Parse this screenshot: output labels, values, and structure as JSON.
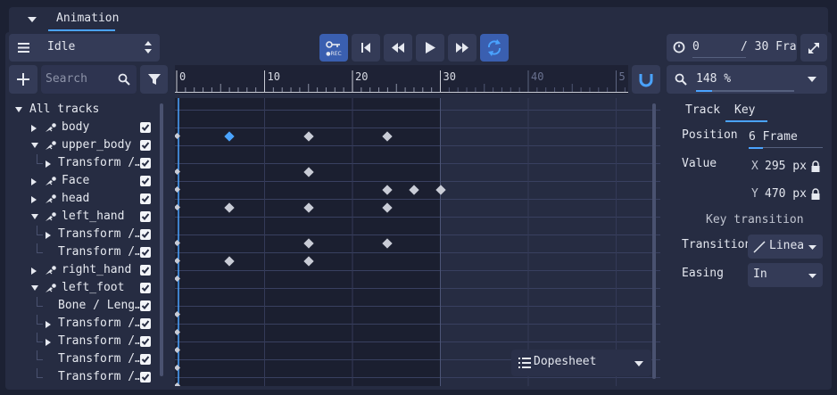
{
  "tab": {
    "label": "Animation"
  },
  "animation_select": {
    "value": "Idle"
  },
  "transport": {
    "buttons": [
      "rec-key",
      "jump-start",
      "step-back",
      "play",
      "step-forward",
      "loop"
    ],
    "current_frame": "0",
    "total_frames": "/ 30 Fra"
  },
  "search": {
    "placeholder": "Search"
  },
  "timeline": {
    "ticks": [
      "0",
      "10",
      "20",
      "30",
      "40",
      "5"
    ],
    "zoom": "148 %",
    "length_frames": 30
  },
  "tracks": [
    {
      "label": "All tracks",
      "indent": 0,
      "expand": "down",
      "icon": false,
      "check": false
    },
    {
      "label": "body",
      "indent": 1,
      "expand": "right",
      "icon": true,
      "check": true,
      "keys": [
        [
          0,
          false
        ],
        [
          6,
          true
        ],
        [
          15,
          false
        ],
        [
          24,
          false
        ]
      ]
    },
    {
      "label": "upper_body",
      "indent": 1,
      "expand": "down",
      "icon": true,
      "check": true,
      "keys": []
    },
    {
      "label": "Transform /…",
      "indent": 2,
      "expand": "right",
      "icon": false,
      "check": true,
      "keys": [
        [
          0,
          false
        ],
        [
          15,
          false
        ]
      ]
    },
    {
      "label": "Face",
      "indent": 1,
      "expand": "right",
      "icon": true,
      "check": true,
      "keys": [
        [
          0,
          false
        ],
        [
          24,
          false
        ],
        [
          27,
          false
        ],
        [
          30,
          false
        ]
      ]
    },
    {
      "label": "head",
      "indent": 1,
      "expand": "right",
      "icon": true,
      "check": true,
      "keys": [
        [
          0,
          false
        ],
        [
          6,
          false
        ],
        [
          15,
          false
        ],
        [
          24,
          false
        ]
      ]
    },
    {
      "label": "left_hand",
      "indent": 1,
      "expand": "down",
      "icon": true,
      "check": true,
      "keys": []
    },
    {
      "label": "Transform /…",
      "indent": 2,
      "expand": "right",
      "icon": false,
      "check": true,
      "keys": [
        [
          0,
          false
        ],
        [
          15,
          false
        ],
        [
          24,
          false
        ]
      ]
    },
    {
      "label": "Transform /…",
      "indent": 2,
      "expand": "none",
      "icon": false,
      "check": true,
      "keys": [
        [
          0,
          false
        ],
        [
          6,
          false
        ],
        [
          15,
          false
        ]
      ]
    },
    {
      "label": "right_hand",
      "indent": 1,
      "expand": "right",
      "icon": true,
      "check": true,
      "keys": [
        [
          0,
          false
        ]
      ]
    },
    {
      "label": "left_foot",
      "indent": 1,
      "expand": "down",
      "icon": true,
      "check": true,
      "keys": []
    },
    {
      "label": "Bone / Leng…",
      "indent": 2,
      "expand": "none",
      "icon": false,
      "check": true,
      "keys": [
        [
          0,
          false
        ]
      ]
    },
    {
      "label": "Transform /…",
      "indent": 2,
      "expand": "right",
      "icon": false,
      "check": true,
      "keys": [
        [
          0,
          false
        ]
      ]
    },
    {
      "label": "Transform /…",
      "indent": 2,
      "expand": "right",
      "icon": false,
      "check": true,
      "keys": [
        [
          0,
          false
        ]
      ]
    },
    {
      "label": "Transform /…",
      "indent": 2,
      "expand": "none",
      "icon": false,
      "check": true,
      "keys": [
        [
          0,
          false
        ]
      ]
    },
    {
      "label": "Transform /…",
      "indent": 2,
      "expand": "none",
      "icon": false,
      "check": true,
      "keys": [
        [
          0,
          false
        ]
      ]
    }
  ],
  "view_mode": {
    "label": "Dopesheet"
  },
  "inspector": {
    "tabs": [
      "Track",
      "Key"
    ],
    "active_tab": "Key",
    "position_label": "Position",
    "position_value": "6 Frame",
    "value_label": "Value",
    "x_label": "X",
    "x_value": "295 px",
    "y_label": "Y",
    "y_value": "470 px",
    "section_title": "Key transition",
    "transition_label": "Transition",
    "transition_value": "Linea",
    "easing_label": "Easing",
    "easing_value": "In"
  },
  "colors": {
    "accent": "#4aa3ff",
    "background": "#1c2133",
    "panel": "#262c42",
    "button": "#343b57"
  }
}
